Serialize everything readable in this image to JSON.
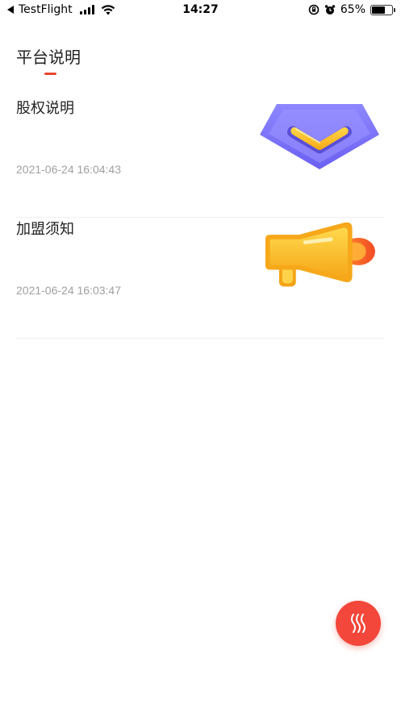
{
  "status_bar": {
    "back_app": "TestFlight",
    "time": "14:27",
    "battery_percent": "65%",
    "battery_level": 0.65,
    "icons": [
      "back-arrow-icon",
      "signal-icon",
      "wifi-icon",
      "rotation-lock-icon",
      "alarm-icon",
      "battery-icon"
    ]
  },
  "header": {
    "tab_label": "平台说明",
    "accent_color": "#e8452c"
  },
  "articles": [
    {
      "title": "股权说明",
      "date": "2021-06-24 16:04:43",
      "icon": "diamond-chevron-icon"
    },
    {
      "title": "加盟须知",
      "date": "2021-06-24 16:03:47",
      "icon": "megaphone-icon"
    }
  ],
  "fab": {
    "icon": "wave-icon",
    "color": "#f2473a"
  }
}
